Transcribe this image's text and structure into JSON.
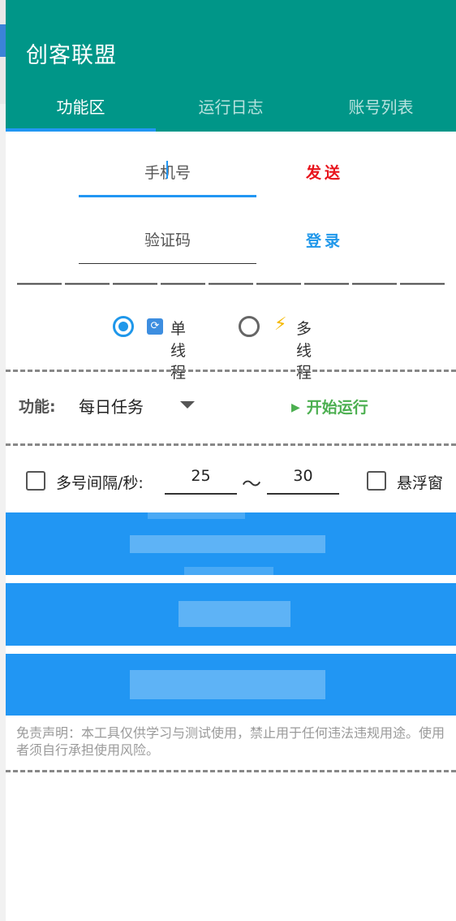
{
  "app": {
    "title": "创客联盟"
  },
  "tabs": [
    {
      "label": "功能区",
      "active": true
    },
    {
      "label": "运行日志",
      "active": false
    },
    {
      "label": "账号列表",
      "active": false
    }
  ],
  "login": {
    "phone_placeholder": "手机号",
    "send_label": "发送",
    "code_placeholder": "验证码",
    "login_label": "登录"
  },
  "threading": {
    "options": [
      {
        "icon": "refresh-icon",
        "label": "单线程",
        "selected": true
      },
      {
        "icon": "lightning-icon",
        "label": "多线程",
        "selected": false
      }
    ]
  },
  "function": {
    "label": "功能:",
    "selected": "每日任务",
    "run_label": "开始运行"
  },
  "interval": {
    "checkbox_label": "多号间隔/秒:",
    "min": "25",
    "max": "30",
    "separator": "～",
    "float_label": "悬浮窗"
  },
  "disclaimer": "免责声明：本工具仅供学习与测试使用，禁止用于任何违法违规用途。使用者须自行承担使用风险。",
  "colors": {
    "primary": "#009688",
    "accent": "#2196f3",
    "send": "#e8141c",
    "login": "#1f97ea",
    "run": "#4caf50"
  }
}
